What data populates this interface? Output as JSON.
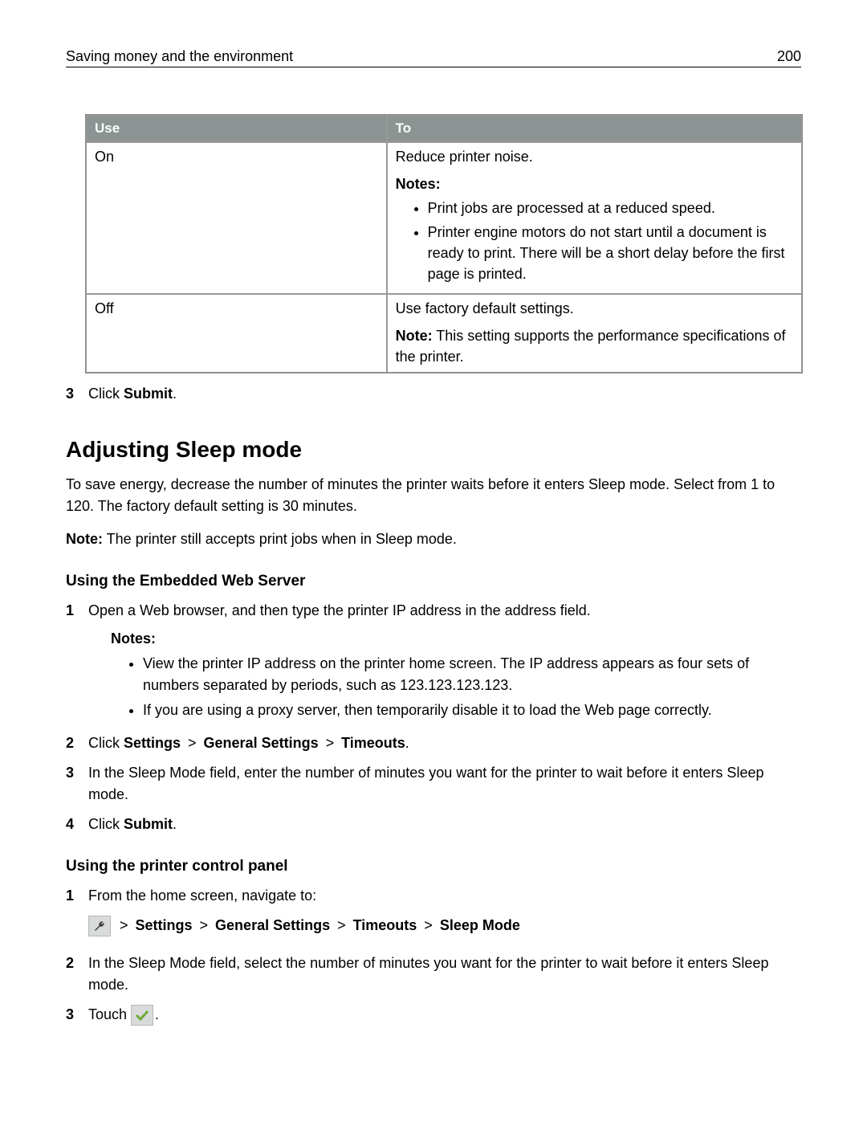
{
  "header": {
    "title": "Saving money and the environment",
    "page": "200"
  },
  "table": {
    "head": {
      "use": "Use",
      "to": "To"
    },
    "rows": [
      {
        "use": "On",
        "to_line": "Reduce printer noise.",
        "notes_label": "Notes:",
        "bullets": [
          "Print jobs are processed at a reduced speed.",
          "Printer engine motors do not start until a document is ready to print. There will be a short delay before the first page is printed."
        ]
      },
      {
        "use": "Off",
        "to_line": "Use factory default settings.",
        "note_prefix": "Note:",
        "note_text": " This setting supports the performance specifications of the printer."
      }
    ]
  },
  "top_step": {
    "num": "3",
    "click": "Click ",
    "submit": "Submit",
    "period": "."
  },
  "section": {
    "title": "Adjusting Sleep mode",
    "para1": "To save energy, decrease the number of minutes the printer waits before it enters Sleep mode. Select from 1 to 120. The factory default setting is 30 minutes.",
    "note_prefix": "Note:",
    "note_text": " The printer still accepts print jobs when in Sleep mode."
  },
  "web": {
    "title": "Using the Embedded Web Server",
    "steps": {
      "s1": {
        "num": "1",
        "text": "Open a Web browser, and then type the printer IP address in the address field."
      },
      "notes_label": "Notes:",
      "bullets": [
        "View the printer IP address on the printer home screen. The IP address appears as four sets of numbers separated by periods, such as 123.123.123.123.",
        "If you are using a proxy server, then temporarily disable it to load the Web page correctly."
      ],
      "s2": {
        "num": "2",
        "click": "Click ",
        "p1": "Settings",
        "gt": " > ",
        "p2": "General Settings",
        "p3": "Timeouts",
        "period": "."
      },
      "s3": {
        "num": "3",
        "text": "In the Sleep Mode field, enter the number of minutes you want for the printer to wait before it enters Sleep mode."
      },
      "s4": {
        "num": "4",
        "click": "Click ",
        "submit": "Submit",
        "period": "."
      }
    }
  },
  "panel": {
    "title": "Using the printer control panel",
    "s1": {
      "num": "1",
      "text": "From the home screen, navigate to:"
    },
    "path": {
      "gt": " > ",
      "p1": "Settings",
      "p2": "General Settings",
      "p3": "Timeouts",
      "p4": "Sleep Mode"
    },
    "s2": {
      "num": "2",
      "text": "In the Sleep Mode field, select the number of minutes you want for the printer to wait before it enters Sleep mode."
    },
    "s3": {
      "num": "3",
      "touch": "Touch ",
      "period": "."
    }
  }
}
